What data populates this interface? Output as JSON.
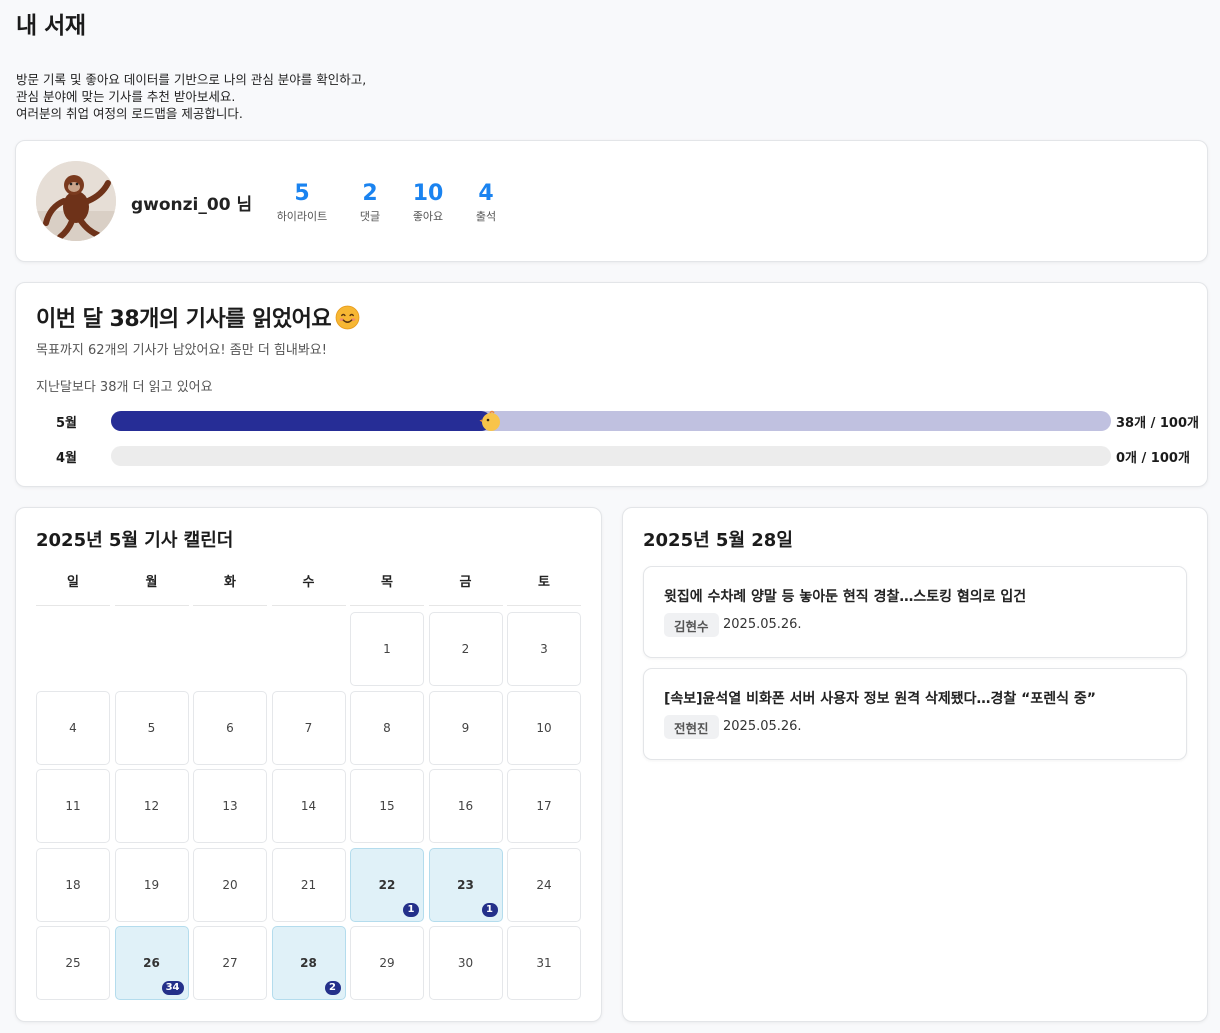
{
  "page": {
    "title": "내 서재",
    "intro_lines": [
      "방문 기록 및 좋아요 데이터를 기반으로 나의 관심 분야를 확인하고,",
      "관심 분야에 맞는 기사를 추천 받아보세요.",
      "여러분의 취업 여정의 로드맵을 제공합니다."
    ]
  },
  "profile": {
    "username": "gwonzi_00 님",
    "avatar_icon": "orangutan-plush-photo",
    "stats": [
      {
        "value": "5",
        "label": "하이라이트"
      },
      {
        "value": "2",
        "label": "댓글"
      },
      {
        "value": "10",
        "label": "좋아요"
      },
      {
        "value": "4",
        "label": "출석"
      }
    ],
    "stat_color": "#1a83f0"
  },
  "reading": {
    "title": "이번 달 38개의 기사를 읽었어요",
    "title_icon": "smiling-face-emoji",
    "subtitle": "목표까지 62개의 기사가 남았어요! 좀만 더 힘내봐요!",
    "compare": "지난달보다 38개 더 읽고 있어요",
    "rows": [
      {
        "month": "5월",
        "count_text": "38개 / 100개",
        "read": 38,
        "goal": 100,
        "fill_color": "#262d96",
        "track_color": "#c0c1e0",
        "marker_icon": "chick-icon"
      },
      {
        "month": "4월",
        "count_text": "0개 / 100개",
        "read": 0,
        "goal": 100,
        "fill_color": "#262d96",
        "track_color": "#ececec"
      }
    ]
  },
  "calendar": {
    "title": "2025년 5월 기사 캘린더",
    "weekdays": [
      "일",
      "월",
      "화",
      "수",
      "목",
      "금",
      "토"
    ],
    "first_weekday_index": 4,
    "days": [
      {
        "day": "1"
      },
      {
        "day": "2"
      },
      {
        "day": "3"
      },
      {
        "day": "4"
      },
      {
        "day": "5"
      },
      {
        "day": "6"
      },
      {
        "day": "7"
      },
      {
        "day": "8"
      },
      {
        "day": "9"
      },
      {
        "day": "10"
      },
      {
        "day": "11"
      },
      {
        "day": "12"
      },
      {
        "day": "13"
      },
      {
        "day": "14"
      },
      {
        "day": "15"
      },
      {
        "day": "16"
      },
      {
        "day": "17"
      },
      {
        "day": "18"
      },
      {
        "day": "19"
      },
      {
        "day": "20"
      },
      {
        "day": "21"
      },
      {
        "day": "22",
        "count": "1"
      },
      {
        "day": "23",
        "count": "1"
      },
      {
        "day": "24"
      },
      {
        "day": "25"
      },
      {
        "day": "26",
        "count": "34"
      },
      {
        "day": "27"
      },
      {
        "day": "28",
        "count": "2"
      },
      {
        "day": "29"
      },
      {
        "day": "30"
      },
      {
        "day": "31"
      }
    ],
    "highlight_color": "#e0f1f8",
    "badge_color": "#24308a"
  },
  "detail": {
    "title": "2025년 5월 28일",
    "articles": [
      {
        "title": "윗집에 수차례 양말 등 놓아둔 현직 경찰…스토킹 혐의로 입건",
        "author": "김현수",
        "date": "2025.05.26."
      },
      {
        "title": "[속보]윤석열 비화폰 서버 사용자 정보 원격 삭제됐다…경찰 “포렌식 중”",
        "author": "전현진",
        "date": "2025.05.26."
      }
    ]
  }
}
